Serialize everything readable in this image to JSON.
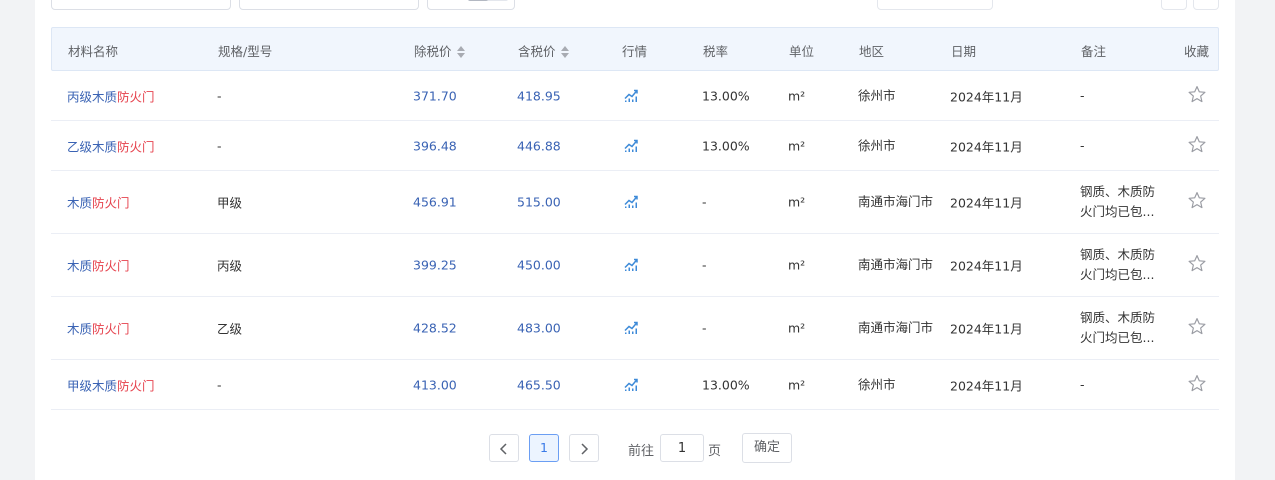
{
  "table": {
    "headers": {
      "name": "材料名称",
      "spec": "规格/型号",
      "price_ex": "除税价",
      "price_in": "含税价",
      "trend": "行情",
      "tax": "税率",
      "unit": "单位",
      "region": "地区",
      "date": "日期",
      "note": "备注",
      "fav": "收藏"
    },
    "rows": [
      {
        "name_prefix": "丙级木质",
        "name_highlight": "防火门",
        "spec": "-",
        "price_ex": "371.70",
        "price_in": "418.95",
        "tax": "13.00%",
        "unit": "m²",
        "region": "徐州市",
        "date": "2024年11月",
        "note": "-"
      },
      {
        "name_prefix": "乙级木质",
        "name_highlight": "防火门",
        "spec": "-",
        "price_ex": "396.48",
        "price_in": "446.88",
        "tax": "13.00%",
        "unit": "m²",
        "region": "徐州市",
        "date": "2024年11月",
        "note": "-"
      },
      {
        "name_prefix": "木质",
        "name_highlight": "防火门",
        "spec": "甲级",
        "price_ex": "456.91",
        "price_in": "515.00",
        "tax": "-",
        "unit": "m²",
        "region": "南通市海门市",
        "date": "2024年11月",
        "note": "钢质、木质防火门均已包..."
      },
      {
        "name_prefix": "木质",
        "name_highlight": "防火门",
        "spec": "丙级",
        "price_ex": "399.25",
        "price_in": "450.00",
        "tax": "-",
        "unit": "m²",
        "region": "南通市海门市",
        "date": "2024年11月",
        "note": "钢质、木质防火门均已包..."
      },
      {
        "name_prefix": "木质",
        "name_highlight": "防火门",
        "spec": "乙级",
        "price_ex": "428.52",
        "price_in": "483.00",
        "tax": "-",
        "unit": "m²",
        "region": "南通市海门市",
        "date": "2024年11月",
        "note": "钢质、木质防火门均已包..."
      },
      {
        "name_prefix": "甲级木质",
        "name_highlight": "防火门",
        "spec": "-",
        "price_ex": "413.00",
        "price_in": "465.50",
        "tax": "13.00%",
        "unit": "m²",
        "region": "徐州市",
        "date": "2024年11月",
        "note": "-"
      }
    ]
  },
  "pagination": {
    "current_page": "1",
    "goto_label": "前往",
    "goto_value": "1",
    "page_suffix": "页",
    "confirm_label": "确定"
  },
  "icons": {
    "trend": "trend-chart-icon",
    "favorite": "star-outline-icon",
    "search": "search-icon",
    "prev": "chevron-left-icon",
    "next": "chevron-right-icon"
  },
  "colors": {
    "link_blue": "#3a63b4",
    "highlight_red": "#e6424d",
    "header_bg": "#f1f6fd",
    "active_page": "#3a7ae8"
  }
}
